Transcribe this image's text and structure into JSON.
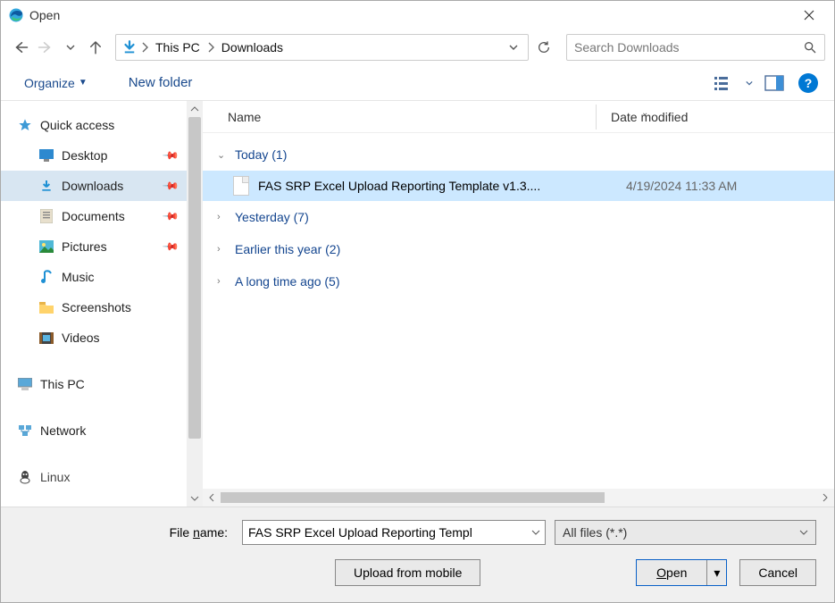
{
  "window": {
    "title": "Open"
  },
  "nav": {
    "refresh_label": "Refresh"
  },
  "breadcrumbs": {
    "root": "This PC",
    "current": "Downloads"
  },
  "search": {
    "placeholder": "Search Downloads"
  },
  "toolbar": {
    "organize": "Organize",
    "new_folder": "New folder"
  },
  "columns": {
    "name": "Name",
    "date": "Date modified"
  },
  "sidebar": {
    "quick_access": "Quick access",
    "desktop": "Desktop",
    "downloads": "Downloads",
    "documents": "Documents",
    "pictures": "Pictures",
    "music": "Music",
    "screenshots": "Screenshots",
    "videos": "Videos",
    "this_pc": "This PC",
    "network": "Network",
    "linux": "Linux"
  },
  "groups": {
    "today": "Today (1)",
    "yesterday": "Yesterday (7)",
    "earlier_year": "Earlier this year (2)",
    "long_ago": "A long time ago (5)"
  },
  "files": {
    "selected": {
      "name": "FAS SRP Excel Upload Reporting Template v1.3....",
      "date": "4/19/2024 11:33 AM"
    }
  },
  "bottom": {
    "filename_label_pre": "File ",
    "filename_label_ul": "n",
    "filename_label_post": "ame:",
    "filename_value": "FAS SRP Excel Upload Reporting Templ",
    "filter": "All files (*.*)",
    "upload": "Upload from mobile",
    "open_ul": "O",
    "open_post": "pen",
    "cancel": "Cancel"
  }
}
